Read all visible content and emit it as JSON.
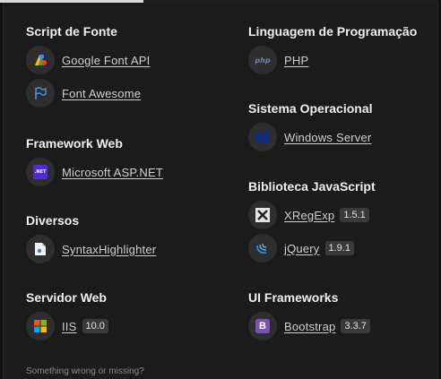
{
  "sections_left": [
    {
      "title": "Script de Fonte",
      "items": [
        {
          "label": "Google Font API",
          "icon": "google-fonts-icon"
        },
        {
          "label": "Font Awesome",
          "icon": "font-awesome-flag-icon"
        }
      ]
    },
    {
      "title": "Framework Web",
      "items": [
        {
          "label": "Microsoft ASP.NET",
          "icon": "dotnet-icon"
        }
      ]
    },
    {
      "title": "Diversos",
      "items": [
        {
          "label": "SyntaxHighlighter",
          "icon": "syntaxhighlighter-icon"
        }
      ]
    },
    {
      "title": "Servidor Web",
      "items": [
        {
          "label": "IIS",
          "version": "10.0",
          "icon": "windows-logo-icon"
        }
      ]
    }
  ],
  "sections_right": [
    {
      "title": "Linguagem de Programação",
      "items": [
        {
          "label": "PHP",
          "icon": "php-icon"
        }
      ]
    },
    {
      "title": "Sistema Operacional",
      "items": [
        {
          "label": "Windows Server",
          "icon": "windows-server-icon"
        }
      ]
    },
    {
      "title": "Biblioteca JavaScript",
      "items": [
        {
          "label": "XRegExp",
          "version": "1.5.1",
          "icon": "xregexp-icon"
        },
        {
          "label": "jQuery",
          "version": "1.9.1",
          "icon": "jquery-icon"
        }
      ]
    },
    {
      "title": "UI Frameworks",
      "items": [
        {
          "label": "Bootstrap",
          "version": "3.3.7",
          "icon": "bootstrap-icon"
        }
      ]
    }
  ],
  "footer": {
    "text": "Something wrong or missing?"
  },
  "colors": {
    "background": "#1b1b1b",
    "bootstrap": "#7952b3",
    "dotnet": "#512bd4",
    "windows_server": "#0a2a9a",
    "php": "#777bb3"
  }
}
